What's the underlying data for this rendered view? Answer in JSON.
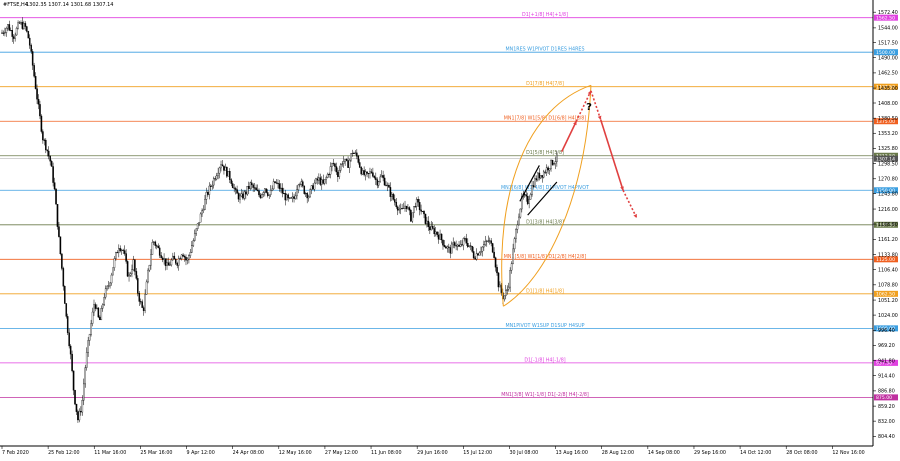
{
  "header": {
    "symbol_label": "#FTSE,H4",
    "ohlc_label": "1302.35 1307.14 1301.68 1307.14"
  },
  "chart_data": {
    "type": "candlestick",
    "title": "#FTSE,H4 1302.35 1307.14 1301.68 1307.14",
    "ylim": [
      787,
      1580
    ],
    "y_ticks": [
      "1572.40",
      "1544.00",
      "1517.50",
      "1490.00",
      "1462.50",
      "1435.00",
      "1408.00",
      "1380.50",
      "1353.20",
      "1325.80",
      "1298.50",
      "1270.80",
      "1243.80",
      "1216.00",
      "1188.80",
      "1161.20",
      "1133.80",
      "1106.40",
      "1078.80",
      "1051.20",
      "1024.00",
      "996.40",
      "969.20",
      "941.80",
      "914.40",
      "886.80",
      "859.20",
      "832.00",
      "804.40"
    ],
    "x_labels": [
      "7 Feb 2020",
      "25 Feb 12:00",
      "11 Mar 16:00",
      "25 Mar 16:00",
      "9 Apr 12:00",
      "24 Apr 08:00",
      "12 May 16:00",
      "27 May 12:00",
      "11 Jun 08:00",
      "29 Jun 16:00",
      "15 Jul 12:00",
      "30 Jul 08:00",
      "13 Aug 16:00",
      "28 Aug 12:00",
      "14 Sep 08:00",
      "29 Sep 16:00",
      "14 Oct 12:00",
      "28 Oct 08:00",
      "12 Nov 16:00"
    ],
    "current_price": 1307.14,
    "current_price_tag": "1307.14",
    "levels": [
      {
        "label": "D1[+1/8] H4[+1/8]",
        "value": 1562.5,
        "tag": "1562.50",
        "color": "#e040e0"
      },
      {
        "label": "MN1RES W1PIVOT D1RES H4RES",
        "value": 1500.0,
        "tag": "1500.00",
        "color": "#3a9ee0"
      },
      {
        "label": "D1[7/8] H4[7/8]",
        "value": 1437.5,
        "tag": "1437.50",
        "color": "#f0a020"
      },
      {
        "label": "MN1[7/8] W1[5/8] D1[6/8] H4[6/8]",
        "value": 1375.0,
        "tag": "1375.00",
        "color": "#f06020"
      },
      {
        "label": "D1[5/8] H4[5/8]",
        "value": 1312.5,
        "tag": "1312.50",
        "color": "#6a7a4a"
      },
      {
        "label": "MN1[6/8] W1[4/8] D1PIVOT H4PIVOT",
        "value": 1250.0,
        "tag": "1250.00",
        "color": "#3a9ee0"
      },
      {
        "label": "D1[3/8] H4[3/8]",
        "value": 1187.5,
        "tag": "1187.50",
        "color": "#6a7a4a"
      },
      {
        "label": "MN1[5/8] W1[1/8] D1[2/8] H4[2/8]",
        "value": 1125.0,
        "tag": "1125.00",
        "color": "#f06020"
      },
      {
        "label": "D1[1/8] H4[1/8]",
        "value": 1062.5,
        "tag": "1062.50",
        "color": "#f0a020"
      },
      {
        "label": "MN1PIVOT W1SUP D1SUP H4SUP",
        "value": 1000.0,
        "tag": "1000.00",
        "color": "#3a9ee0"
      },
      {
        "label": "D1[-1/8] H4[-1/8]",
        "value": 937.5,
        "tag": "937.50",
        "color": "#e040e0"
      },
      {
        "label": "MN1[3/8] W1[-1/8] D1[-2/8] H4[-2/8]",
        "value": 875.0,
        "tag": "875.00",
        "color": "#c030a0"
      }
    ],
    "price_path": [
      [
        0,
        1535
      ],
      [
        6,
        1548
      ],
      [
        12,
        1530
      ],
      [
        18,
        1552
      ],
      [
        24,
        1545
      ],
      [
        28,
        1520
      ],
      [
        32,
        1470
      ],
      [
        37,
        1405
      ],
      [
        42,
        1345
      ],
      [
        46,
        1325
      ],
      [
        50,
        1300
      ],
      [
        54,
        1250
      ],
      [
        58,
        1170
      ],
      [
        62,
        1100
      ],
      [
        66,
        1020
      ],
      [
        70,
        960
      ],
      [
        74,
        880
      ],
      [
        78,
        835
      ],
      [
        82,
        860
      ],
      [
        86,
        940
      ],
      [
        90,
        990
      ],
      [
        95,
        1050
      ],
      [
        100,
        1010
      ],
      [
        105,
        1060
      ],
      [
        110,
        1080
      ],
      [
        115,
        1120
      ],
      [
        120,
        1150
      ],
      [
        125,
        1140
      ],
      [
        130,
        1090
      ],
      [
        135,
        1120
      ],
      [
        140,
        1060
      ],
      [
        145,
        1030
      ],
      [
        150,
        1100
      ],
      [
        155,
        1160
      ],
      [
        160,
        1145
      ],
      [
        165,
        1130
      ],
      [
        170,
        1110
      ],
      [
        175,
        1125
      ],
      [
        180,
        1120
      ],
      [
        185,
        1140
      ],
      [
        190,
        1120
      ],
      [
        195,
        1150
      ],
      [
        200,
        1180
      ],
      [
        205,
        1210
      ],
      [
        210,
        1240
      ],
      [
        215,
        1260
      ],
      [
        220,
        1280
      ],
      [
        225,
        1300
      ],
      [
        230,
        1285
      ],
      [
        235,
        1270
      ],
      [
        240,
        1245
      ],
      [
        245,
        1235
      ],
      [
        250,
        1245
      ],
      [
        255,
        1260
      ],
      [
        260,
        1250
      ],
      [
        265,
        1240
      ],
      [
        270,
        1255
      ],
      [
        275,
        1240
      ],
      [
        280,
        1265
      ],
      [
        285,
        1255
      ],
      [
        290,
        1240
      ],
      [
        295,
        1230
      ],
      [
        300,
        1235
      ],
      [
        305,
        1270
      ],
      [
        310,
        1250
      ],
      [
        315,
        1240
      ],
      [
        320,
        1260
      ],
      [
        325,
        1270
      ],
      [
        330,
        1260
      ],
      [
        335,
        1280
      ],
      [
        340,
        1300
      ],
      [
        345,
        1280
      ],
      [
        350,
        1305
      ],
      [
        355,
        1295
      ],
      [
        360,
        1320
      ],
      [
        365,
        1310
      ],
      [
        370,
        1280
      ],
      [
        375,
        1275
      ],
      [
        380,
        1285
      ],
      [
        385,
        1265
      ],
      [
        390,
        1275
      ],
      [
        395,
        1260
      ],
      [
        400,
        1240
      ],
      [
        405,
        1225
      ],
      [
        410,
        1210
      ],
      [
        415,
        1225
      ],
      [
        420,
        1200
      ],
      [
        425,
        1230
      ],
      [
        430,
        1215
      ],
      [
        435,
        1195
      ],
      [
        440,
        1180
      ],
      [
        445,
        1175
      ],
      [
        450,
        1165
      ],
      [
        455,
        1150
      ],
      [
        460,
        1140
      ],
      [
        465,
        1155
      ],
      [
        470,
        1145
      ],
      [
        475,
        1160
      ],
      [
        480,
        1150
      ],
      [
        485,
        1130
      ],
      [
        490,
        1140
      ],
      [
        495,
        1150
      ],
      [
        500,
        1160
      ],
      [
        505,
        1140
      ],
      [
        510,
        1080
      ],
      [
        515,
        1055
      ],
      [
        520,
        1075
      ],
      [
        525,
        1140
      ],
      [
        530,
        1200
      ],
      [
        535,
        1240
      ],
      [
        540,
        1230
      ],
      [
        545,
        1260
      ],
      [
        550,
        1275
      ],
      [
        555,
        1280
      ],
      [
        560,
        1290
      ],
      [
        565,
        1300
      ],
      [
        570,
        1307
      ]
    ],
    "projection_path": [
      [
        575,
        1320
      ],
      [
        590,
        1375
      ],
      [
        605,
        1430
      ],
      [
        615,
        1378
      ],
      [
        638,
        1250
      ],
      [
        652,
        1200
      ]
    ],
    "projection_color": "#e04040",
    "channel_color": "#f0a020",
    "question_mark": "?"
  }
}
